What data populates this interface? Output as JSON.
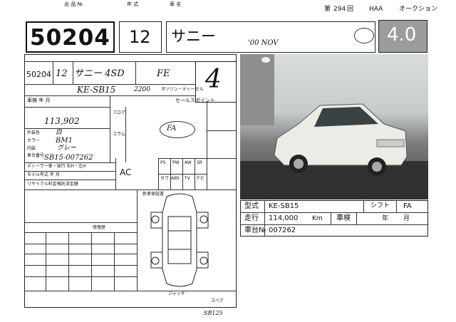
{
  "header": {
    "lot_label": "出 品 №",
    "year_label": "年 式",
    "name_label": "車 名",
    "auction_no_prefix": "第",
    "auction_no": "294",
    "auction_no_suffix": "回",
    "house": "HAA",
    "auction_word": "オークション"
  },
  "lot": {
    "number": "50204",
    "year": "12",
    "car_name": "サニー",
    "date_note": "'00 NOV",
    "grade": "4.0"
  },
  "sheet": {
    "lot_small": "50204",
    "year_small": "12",
    "name_hand": "サニー 4SD",
    "grade_hand": "FE",
    "model_code_hand": "KE-SB15",
    "displacement": "2200",
    "fuel": "ガソリン・ディーゼル",
    "score_hand": "4",
    "inspection_label": "車検 年 月",
    "mileage_hand": "113,902",
    "color_label": "外装色",
    "color_hand": "白",
    "color_code_label": "カラー",
    "color_code": "BM1",
    "interior_label": "内装",
    "interior_hand": "グレー",
    "chassis_label": "車台番号",
    "chassis_hand": "SB15-007262",
    "dealer_label": "ディーラー車・並行 右H・左H",
    "model_change_label": "モデル年式 年 月",
    "recycle_label": "リサイクル料金預託済金額",
    "ac": "AC",
    "options": [
      "PS",
      "PW",
      "AW",
      "SR",
      "カワ",
      "ABS",
      "TV",
      "ナビ"
    ],
    "steer_label": "コラム",
    "floor_label": "フロア",
    "shift_hand": "FA",
    "sales_point_label": "セールスポイント",
    "new_car_label": "新車保証書",
    "repair_label": "修復歴",
    "jack_label": "ジャッキ",
    "spare_label": "スペア",
    "bottom_note": "SB125"
  },
  "info": {
    "model_label": "型式",
    "model_value": "KE-SB15",
    "shift_label": "シフト",
    "shift_value": "FA",
    "mileage_label": "走行",
    "mileage_value": "114,000",
    "mileage_unit": "Km",
    "inspection_label": "車検",
    "year_unit": "年",
    "month_unit": "月",
    "chassis_label": "車台№",
    "chassis_value": "007262"
  },
  "colors": {
    "grade_bg": "#9c9c9c",
    "car_body": "#ecece6"
  }
}
